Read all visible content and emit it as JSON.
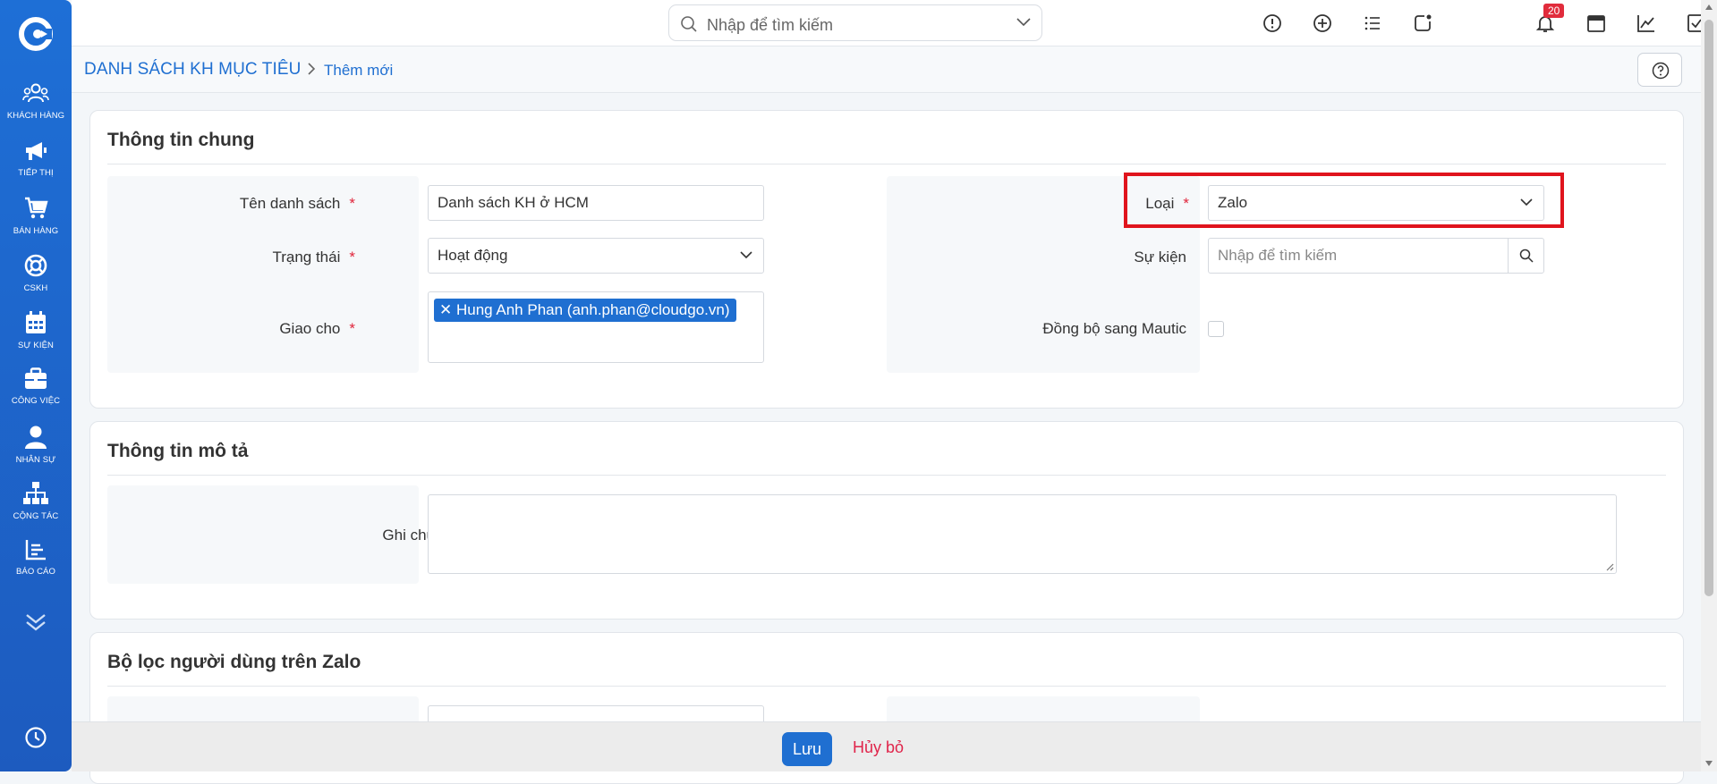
{
  "sidebar": {
    "items": [
      {
        "label": "KHÁCH HÀNG",
        "icon": "users-icon"
      },
      {
        "label": "TIẾP THỊ",
        "icon": "megaphone-icon"
      },
      {
        "label": "BÁN HÀNG",
        "icon": "cart-icon"
      },
      {
        "label": "CSKH",
        "icon": "lifebuoy-icon"
      },
      {
        "label": "SỰ KIỆN",
        "icon": "calendar-icon"
      },
      {
        "label": "CÔNG VIỆC",
        "icon": "briefcase-icon"
      },
      {
        "label": "NHÂN SỰ",
        "icon": "person-icon"
      },
      {
        "label": "CỘNG TÁC",
        "icon": "org-chart-icon"
      },
      {
        "label": "BÁO CÁO",
        "icon": "report-icon"
      }
    ]
  },
  "topbar": {
    "search_placeholder": "Nhập để tìm kiếm",
    "notification_count": "20"
  },
  "breadcrumb": {
    "root": "DANH SÁCH KH MỤC TIÊU",
    "current": "Thêm mới"
  },
  "section_general": {
    "title": "Thông tin chung",
    "name_label": "Tên danh sách",
    "name_value": "Danh sách KH ở HCM",
    "status_label": "Trạng thái",
    "status_value": "Hoạt động",
    "assign_label": "Giao cho",
    "assign_tag": "✕ Hung Anh Phan (anh.phan@cloudgo.vn)",
    "type_label": "Loại",
    "type_value": "Zalo",
    "event_label": "Sự kiện",
    "event_placeholder": "Nhập để tìm kiếm",
    "sync_label": "Đồng bộ sang Mautic"
  },
  "section_desc": {
    "title": "Thông tin mô tả",
    "note_label": "Ghi chú"
  },
  "section_filter": {
    "title": "Bộ lọc người dùng trên Zalo"
  },
  "footer": {
    "save_label": "Lưu",
    "cancel_label": "Hủy bỏ"
  },
  "colors": {
    "primary": "#1f6fd1",
    "danger": "#e0243a",
    "highlight": "#e0141d"
  }
}
